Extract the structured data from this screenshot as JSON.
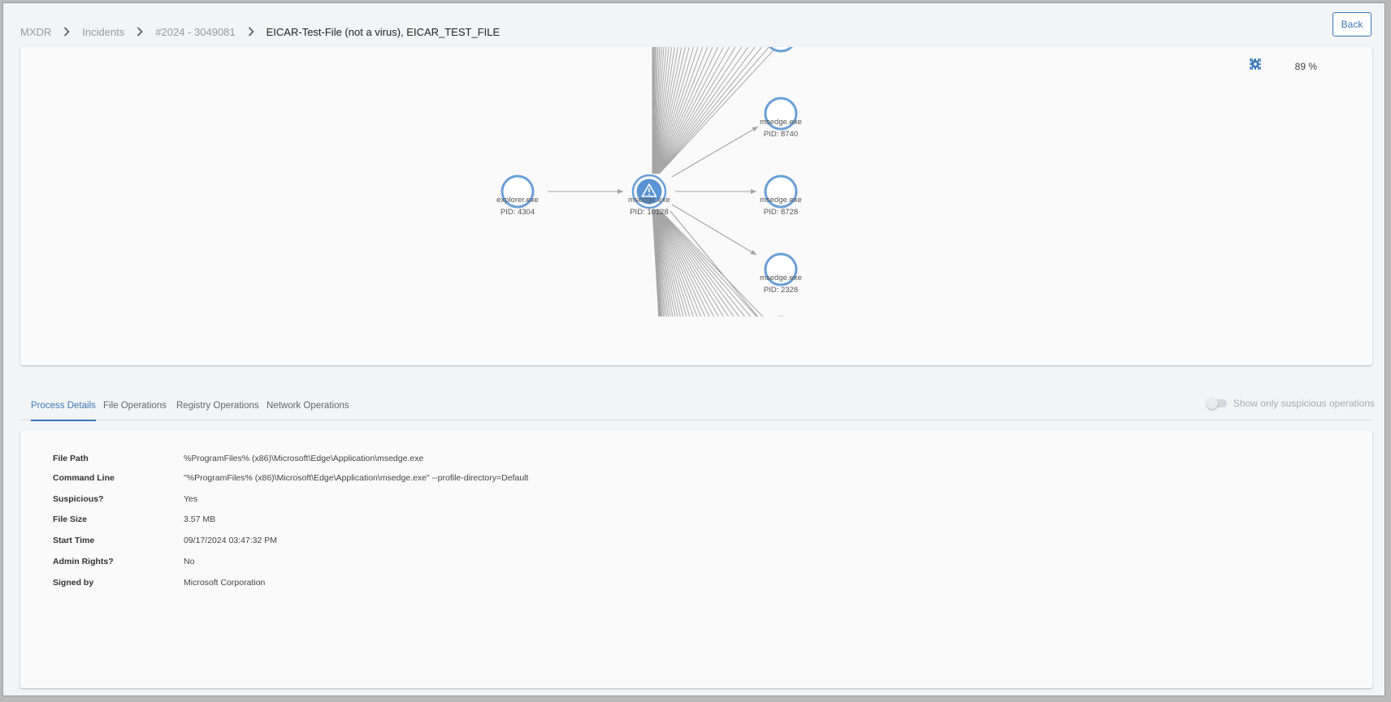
{
  "breadcrumb": {
    "items": [
      "MXDR",
      "Incidents",
      "#2024 - 3049081"
    ],
    "current": "EICAR-Test-File (not a virus), EICAR_TEST_FILE"
  },
  "header": {
    "back_label": "Back"
  },
  "graph": {
    "zoom": "89 %",
    "nodes": [
      {
        "name": "explorer.exe",
        "pid": "PID: 4304",
        "alert": false
      },
      {
        "name": "msedge.exe",
        "pid": "PID: 10128",
        "alert": true
      },
      {
        "name": "msedge.exe",
        "pid": "PID: 8740",
        "alert": false
      },
      {
        "name": "msedge.exe",
        "pid": "PID: 8728",
        "alert": false
      },
      {
        "name": "msedge.exe",
        "pid": "PID: 2328",
        "alert": false
      }
    ],
    "colors": {
      "node": "#6a9fd8",
      "alert_fill": "#5b94d4",
      "edge": "#a3a3a3"
    }
  },
  "tabs": [
    {
      "label": "Process Details",
      "active": true
    },
    {
      "label": "File Operations",
      "active": false
    },
    {
      "label": "Registry Operations",
      "active": false
    },
    {
      "label": "Network Operations",
      "active": false
    }
  ],
  "toggle": {
    "label": "Show only suspicious operations",
    "on": false
  },
  "details": [
    {
      "key": "File Path",
      "value": "%ProgramFiles% (x86)\\Microsoft\\Edge\\Application\\msedge.exe"
    },
    {
      "key": "Command Line",
      "value": "\"%ProgramFiles% (x86)\\Microsoft\\Edge\\Application\\msedge.exe\" --profile-directory=Default"
    },
    {
      "key": "Suspicious?",
      "value": "Yes"
    },
    {
      "key": "File Size",
      "value": "3.57 MB"
    },
    {
      "key": "Start Time",
      "value": "09/17/2024 03:47:32 PM"
    },
    {
      "key": "Admin Rights?",
      "value": "No"
    },
    {
      "key": "Signed by",
      "value": "Microsoft Corporation"
    }
  ],
  "accent_color": "#3a78b8"
}
